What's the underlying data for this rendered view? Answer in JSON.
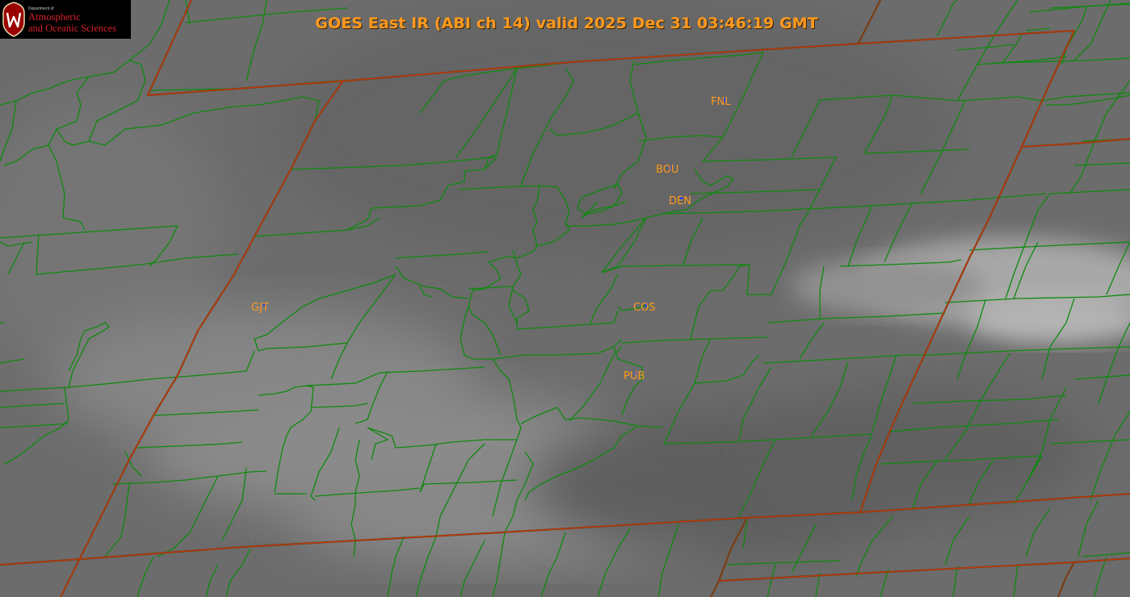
{
  "header": {
    "title": "GOES East IR (ABI ch 14) valid 2025 Dec 31 03:46:19 GMT"
  },
  "logo": {
    "department": "Department of",
    "line1": "Atmospheric",
    "line2": "and Oceanic Sciences",
    "seal_letter": "W",
    "seal_color": "#9b0000"
  },
  "stations": [
    {
      "id": "FNL",
      "label": "FNL"
    },
    {
      "id": "BOU",
      "label": "BOU"
    },
    {
      "id": "DEN",
      "label": "DEN"
    },
    {
      "id": "GJT",
      "label": "GJT"
    },
    {
      "id": "COS",
      "label": "COS"
    },
    {
      "id": "PUB",
      "label": "PUB"
    }
  ],
  "colors": {
    "county_lines": "#0e8a0e",
    "state_lines": "#7a3d14",
    "state_highlight": "#ff3300",
    "station_labels": "#ff9a1e",
    "station_markers": "#1a3cff",
    "background_ir": "#6e6e6e"
  }
}
